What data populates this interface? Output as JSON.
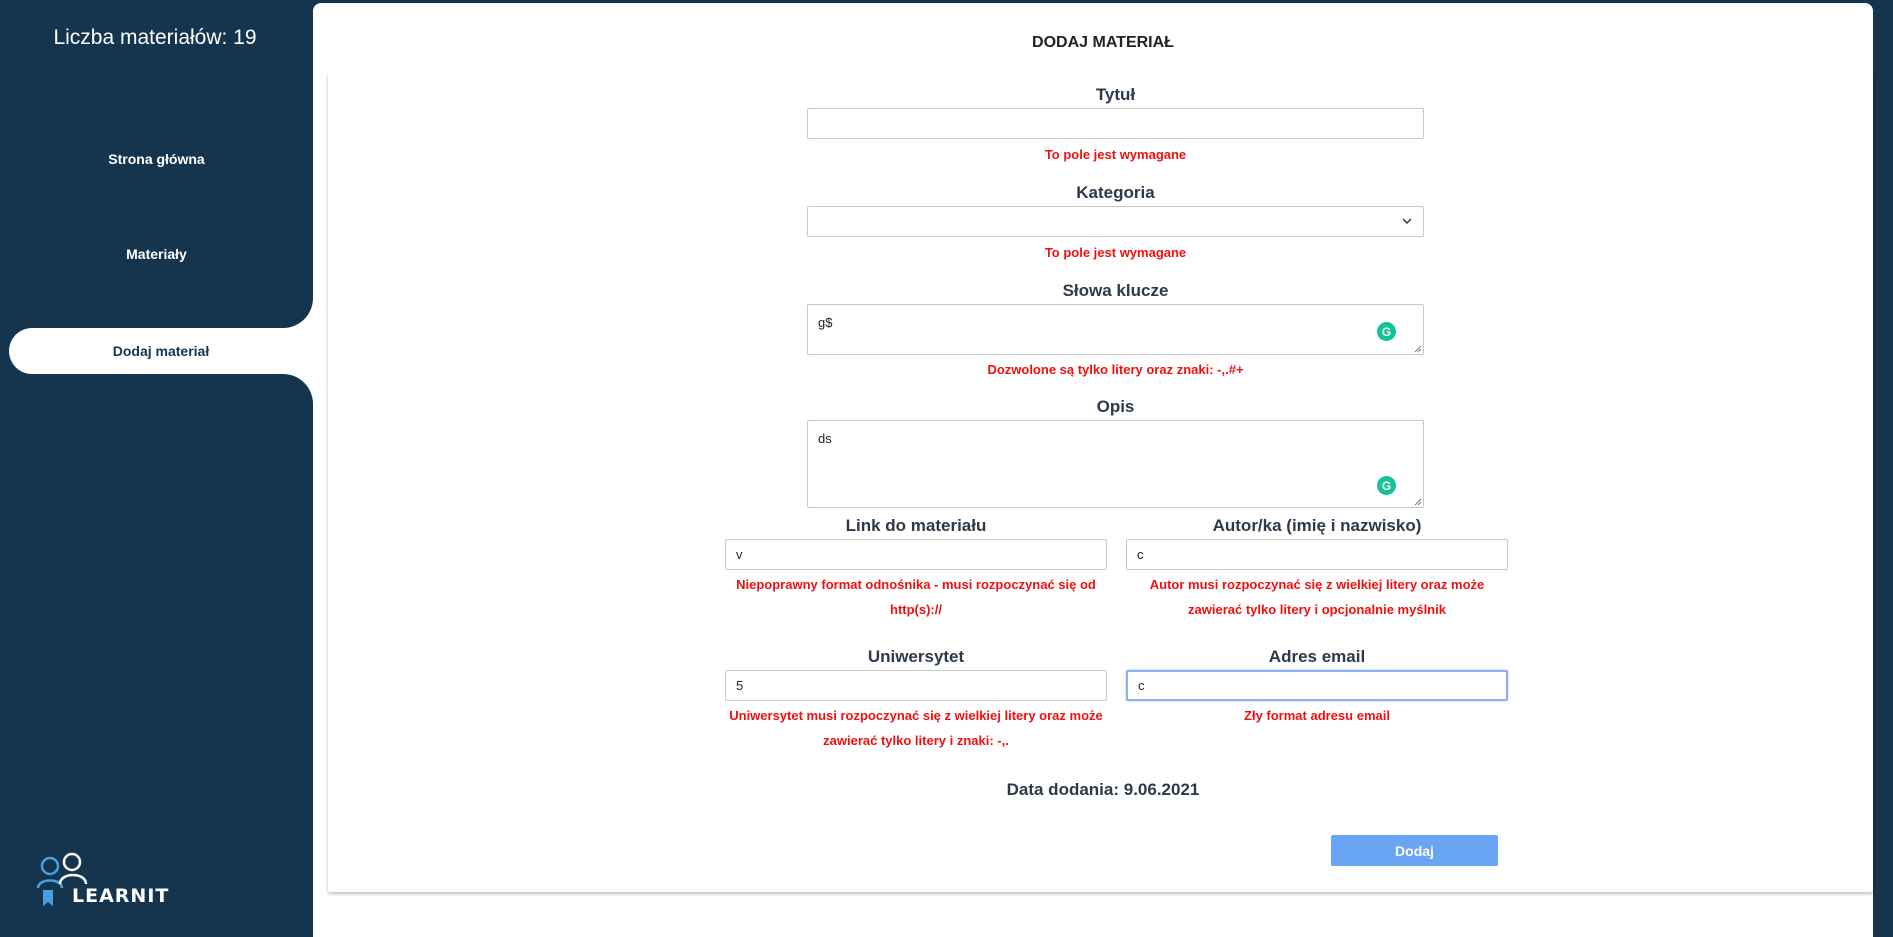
{
  "sidebar": {
    "count_label": "Liczba materiałów: 19",
    "nav": {
      "home": "Strona główna",
      "materials": "Materiały",
      "add_material": "Dodaj materiał"
    },
    "logo_text": "LEARNIT"
  },
  "main": {
    "heading": "DODAJ MATERIAŁ",
    "fields": {
      "title": {
        "label": "Tytuł",
        "value": "",
        "error": "To pole jest wymagane"
      },
      "category": {
        "label": "Kategoria",
        "value": "",
        "error": "To pole jest wymagane"
      },
      "keywords": {
        "label": "Słowa klucze",
        "value": "g$",
        "error": "Dozwolone są tylko litery oraz znaki: -,.#+"
      },
      "description": {
        "label": "Opis",
        "value": "ds"
      },
      "link": {
        "label": "Link do materiału",
        "value": "v",
        "error_line1": "Niepoprawny format odnośnika - musi rozpoczynać się od",
        "error_line2": "http(s)://"
      },
      "author": {
        "label": "Autor/ka (imię i nazwisko)",
        "value": "c",
        "error_line1": "Autor musi rozpoczynać się z wielkiej litery oraz może",
        "error_line2": "zawierać tylko litery i opcjonalnie myślnik"
      },
      "university": {
        "label": "Uniwersytet",
        "value": "5",
        "error_line1": "Uniwersytet musi rozpoczynać się z wielkiej litery oraz może",
        "error_line2": "zawierać tylko litery i znaki: -,."
      },
      "email": {
        "label": "Adres email",
        "value": "c",
        "error": "Zły format adresu email"
      }
    },
    "date_label": "Data dodania: 9.06.2021",
    "submit_label": "Dodaj"
  },
  "colors": {
    "sidebar_bg": "#15354f",
    "error": "#ee1111",
    "submit_bg": "#6aa5f5",
    "grammarly": "#15c39a"
  },
  "icons": [
    "learnit-logo-icon",
    "chevron-down-icon",
    "grammarly-icon"
  ]
}
